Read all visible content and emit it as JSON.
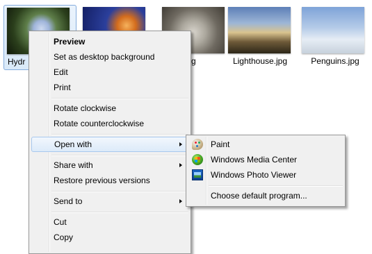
{
  "files": [
    {
      "name": "Hydr",
      "thumb": "hydrangeas-thumbnail",
      "selected": true
    },
    {
      "name": "",
      "thumb": "jellyfish-thumbnail"
    },
    {
      "name": ".jpg",
      "thumb": "koala-thumbnail"
    },
    {
      "name": "Lighthouse.jpg",
      "thumb": "lighthouse-thumbnail"
    },
    {
      "name": "Penguins.jpg",
      "thumb": "penguins-thumbnail"
    }
  ],
  "context_menu": {
    "items": [
      {
        "label": "Preview",
        "bold": true
      },
      {
        "label": "Set as desktop background"
      },
      {
        "label": "Edit"
      },
      {
        "label": "Print"
      },
      {
        "label": "Rotate clockwise"
      },
      {
        "label": "Rotate counterclockwise"
      },
      {
        "label": "Open with",
        "submenu": true,
        "highlighted": true
      },
      {
        "label": "Share with",
        "submenu": true
      },
      {
        "label": "Restore previous versions"
      },
      {
        "label": "Send to",
        "submenu": true
      },
      {
        "label": "Cut"
      },
      {
        "label": "Copy"
      }
    ]
  },
  "open_with_menu": {
    "items": [
      {
        "label": "Paint",
        "icon": "paint-icon"
      },
      {
        "label": "Windows Media Center",
        "icon": "windows-media-center-icon"
      },
      {
        "label": "Windows Photo Viewer",
        "icon": "windows-photo-viewer-icon"
      },
      {
        "label": "Choose default program..."
      }
    ]
  },
  "colors": {
    "selection_fill": "#d9e9f9",
    "selection_border": "#84acdd",
    "menu_background": "#f0f0f0",
    "menu_border": "#979797",
    "hover_border": "#a8c8ee"
  }
}
